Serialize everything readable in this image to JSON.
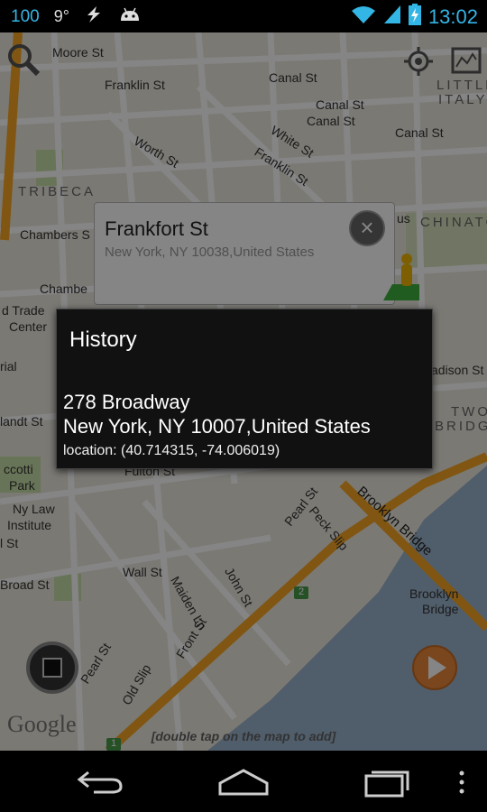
{
  "status_bar": {
    "battery_level_text": "100",
    "temperature": "9°",
    "time": "13:02",
    "icons": [
      "usb-debug-icon",
      "android-icon",
      "wifi-icon",
      "cell-signal-icon",
      "battery-charging-icon"
    ]
  },
  "map": {
    "labels": {
      "moore": "Moore St",
      "franklin": "Franklin St",
      "canal_top": "Canal St",
      "canal_mid": "Canal St",
      "canal_mid2": "Canal St",
      "canal_right": "Canal St",
      "little_italy": "LITTLE",
      "italy": "ITALY",
      "white": "White St",
      "worth": "Worth St",
      "franklin_diag": "Franklin St",
      "tribeca": "TRIBECA",
      "chambers": "Chambers S",
      "chambe": "Chambe",
      "chinatown": "CHINATO",
      "us": "us",
      "trade": "d Trade",
      "center": "Center",
      "rial": "rial",
      "landt": "landt St",
      "madison": "adison St",
      "two": "TWO",
      "bridg": "BRIDG",
      "fulton": "Fulton St",
      "occotti": "ccotti",
      "park": "Park",
      "nylaw": "Ny Law",
      "institute": "Institute",
      "lst": "l St",
      "wall": "Wall St",
      "broad": "Broad St",
      "pearl": "Pearl St",
      "peck": "Peck Slip",
      "brooklyn_bridge": "Brooklyn Bridge",
      "brooklyn": "Brooklyn",
      "bridge": "Bridge",
      "john": "John St",
      "maiden": "Maiden Ln",
      "front": "Front St",
      "pearl2": "Pearl St",
      "old_slip": "Old Slip",
      "google": "Google",
      "route_badge": "2",
      "route_badge2": "1"
    },
    "hint": "[double tap on the map to add]"
  },
  "info_card": {
    "title": "Frankfort St",
    "subtitle": "New York, NY 10038,United States"
  },
  "dialog": {
    "title": "History",
    "address_line1": "278 Broadway",
    "address_line2": "New York, NY 10007,United States",
    "location": "location: (40.714315, -74.006019)"
  },
  "colors": {
    "accent": "#33b5e5",
    "water": "#99b3cc",
    "road_major": "#f5a623",
    "park": "#c8dfa8"
  }
}
